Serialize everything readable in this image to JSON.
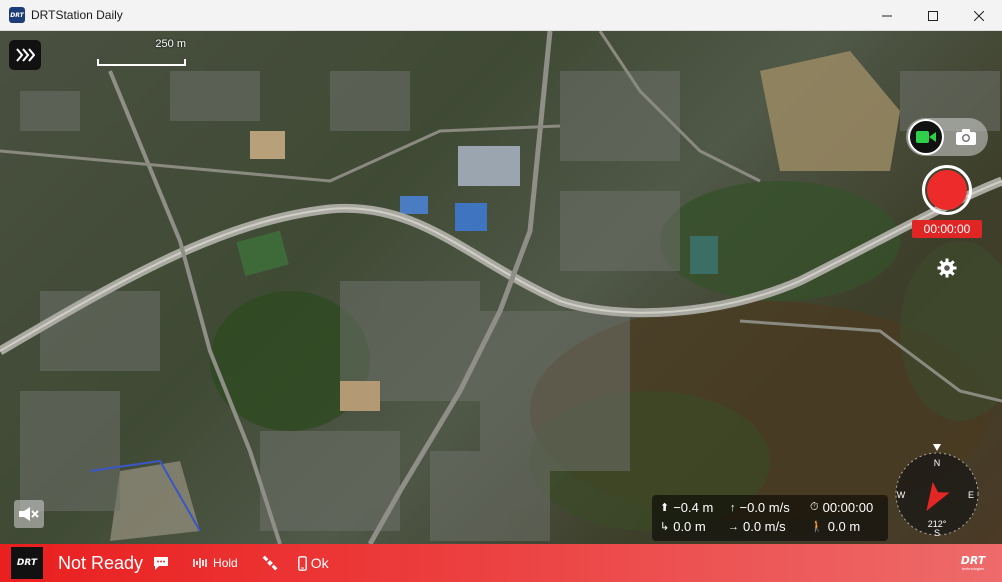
{
  "window": {
    "title": "DRTStation Daily",
    "app_icon_text": "DRT",
    "controls": [
      "minimize-icon",
      "maximize-icon",
      "close-icon"
    ]
  },
  "map": {
    "scale_label": "250 m",
    "menu_icon": "chevrons-right-icon"
  },
  "camera": {
    "mode_selected": "video",
    "video_icon": "video-camera-icon",
    "photo_icon": "camera-icon",
    "record_timer": "00:00:00",
    "record_color": "#ee2b2b",
    "settings_icon": "gear-icon"
  },
  "telemetry": {
    "altitude": "−0.4 m",
    "vertical_speed": "−0.0 m/s",
    "flight_time": "00:00:00",
    "distance": "0.0 m",
    "horizontal_speed": "0.0 m/s",
    "home_distance": "0.0 m"
  },
  "compass": {
    "heading_label": "212°",
    "north": "N",
    "east": "E",
    "south": "S",
    "west": "W",
    "heading_deg": 212,
    "arrow_color": "#e32626"
  },
  "statusbar": {
    "logo_text": "DRT",
    "status": "Not Ready",
    "hold_label": "Hold",
    "phone_label": "Ok",
    "brand_text": "DRT",
    "brand_sub": "technologies",
    "bg_color": "#ea1f1f"
  }
}
